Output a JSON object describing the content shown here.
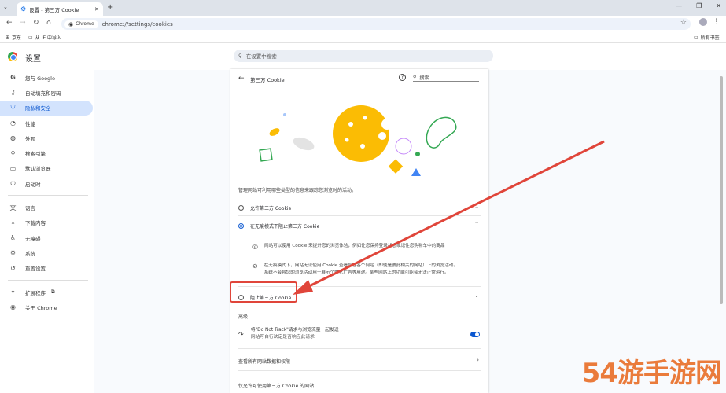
{
  "browser": {
    "tab_title": "设置 - 第三方 Cookie",
    "url_chip": "Chrome",
    "url": "chrome://settings/cookies",
    "bookmarks": [
      "京东",
      "从 IE 中导入"
    ],
    "all_bookmarks": "所有书签"
  },
  "header": {
    "title": "设置",
    "search_placeholder": "在设置中搜索"
  },
  "sidebar": {
    "items": [
      {
        "label": "您与 Google",
        "icon": "google-icon"
      },
      {
        "label": "自动填充和密码",
        "icon": "key-icon"
      },
      {
        "label": "隐私和安全",
        "icon": "shield-icon",
        "active": true
      },
      {
        "label": "性能",
        "icon": "speedometer-icon"
      },
      {
        "label": "外观",
        "icon": "palette-icon"
      },
      {
        "label": "搜索引擎",
        "icon": "search-icon"
      },
      {
        "label": "默认浏览器",
        "icon": "browser-icon"
      },
      {
        "label": "启动时",
        "icon": "power-icon"
      },
      {
        "label": "语言",
        "icon": "translate-icon"
      },
      {
        "label": "下载内容",
        "icon": "download-icon"
      },
      {
        "label": "无障碍",
        "icon": "accessibility-icon"
      },
      {
        "label": "系统",
        "icon": "wrench-icon"
      },
      {
        "label": "重置设置",
        "icon": "reset-icon"
      },
      {
        "label": "扩展程序",
        "icon": "puzzle-icon"
      },
      {
        "label": "关于 Chrome",
        "icon": "chrome-icon"
      }
    ]
  },
  "main": {
    "title": "第三方 Cookie",
    "search_placeholder": "搜索",
    "description": "管理网站可利用哪些类型的信息来跟踪您浏览时的活动。",
    "options": [
      {
        "label": "允许第三方 Cookie",
        "selected": false
      },
      {
        "label": "在无痕模式下阻止第三方 Cookie",
        "selected": true
      },
      {
        "label": "阻止第三方 Cookie",
        "selected": false
      }
    ],
    "sub1": "网站可以使用 Cookie 来提升您的浏览体验，例如让您保持登录状态或记住您购物车中的商品",
    "sub2_line1": "在无痕模式下，网站无法使用 Cookie 查看您在各个网站（即使是彼此相关的网站）上的浏览活动。",
    "sub2_line2": "系统不会将您的浏览活动用于展示个性化广告等用途。某些网站上的功能可能会无法正常运行。",
    "advanced": "高级",
    "dnt_line1": "将\"Do Not Track\"请求与浏览流量一起发送",
    "dnt_line2": "网站可自行决定是否响应此请求",
    "see_all": "查看所有网站数据和权限",
    "allowed_sites": "仅允许可使用第三方 Cookie 的网站"
  },
  "watermark": "54游手游网"
}
